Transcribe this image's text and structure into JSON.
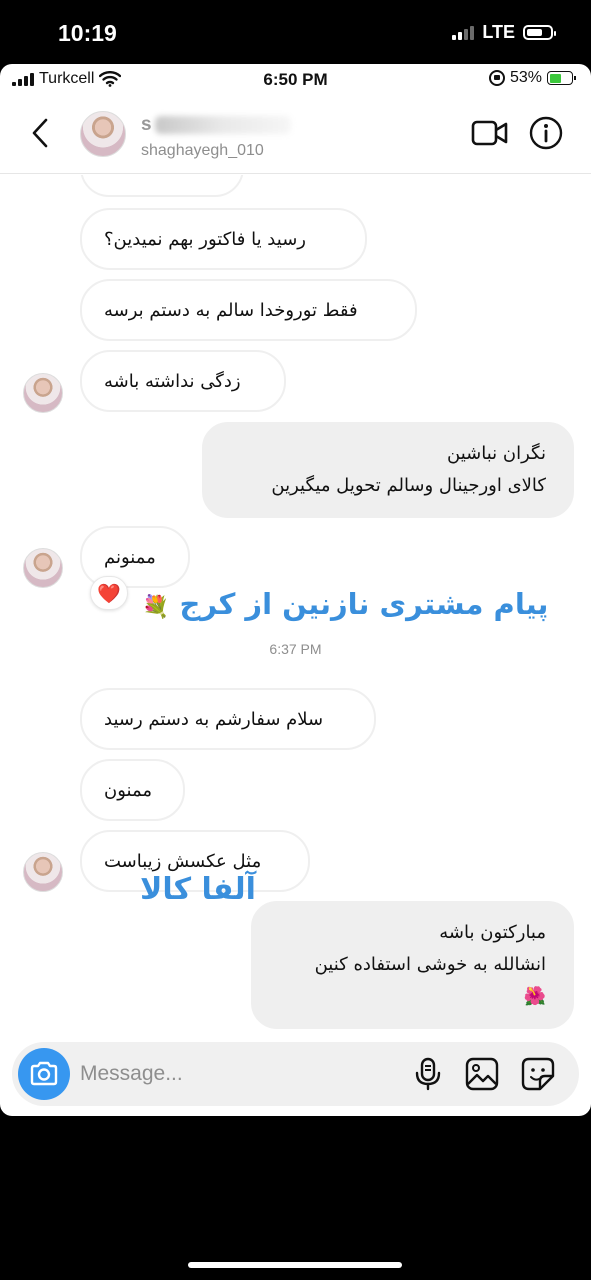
{
  "outer_status": {
    "time": "10:19",
    "network": "LTE"
  },
  "inner_status": {
    "carrier": "Turkcell",
    "time": "6:50 PM",
    "battery": "53%"
  },
  "header": {
    "name": "s",
    "username": "shaghayegh_010"
  },
  "messages": [
    {
      "text": ""
    },
    {
      "text": "رسید یا فاکتور بهم نمیدین؟"
    },
    {
      "text": "فقط توروخدا سالم به دستم برسه"
    },
    {
      "text": "زدگی نداشته باشه"
    },
    {
      "line1": "نگران نباشین",
      "line2": "کالای اورجینال وسالم تحویل میگیرین"
    },
    {
      "text": "ممنونم",
      "reaction": "❤️"
    },
    {
      "text": "سلام سفارشم به دستم رسید"
    },
    {
      "text": "ممنون"
    },
    {
      "text": "مثل عکسش زیباست"
    },
    {
      "line1": "مبارکتون باشه",
      "line2": "انشالله به خوشی استفاده کنین",
      "line3": "🌺"
    }
  ],
  "overlays": {
    "caption": "پیام مشتری نازنین از کرج",
    "caption_emoji": "💐",
    "brand": "آلفا کالا"
  },
  "timestamp": "6:37 PM",
  "composer": {
    "placeholder": "Message..."
  }
}
